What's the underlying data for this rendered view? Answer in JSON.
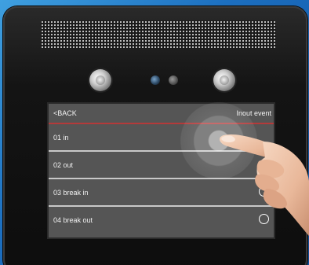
{
  "screen": {
    "back_label": "<BACK",
    "title": "Inout event"
  },
  "menu": {
    "items": [
      {
        "label": "01 in"
      },
      {
        "label": "02 out"
      },
      {
        "label": "03 break in"
      },
      {
        "label": "04 break out"
      }
    ]
  },
  "colors": {
    "screen_bg": "#555555",
    "header_divider": "#b43a3a",
    "background_blue": "#1c6fc0"
  }
}
